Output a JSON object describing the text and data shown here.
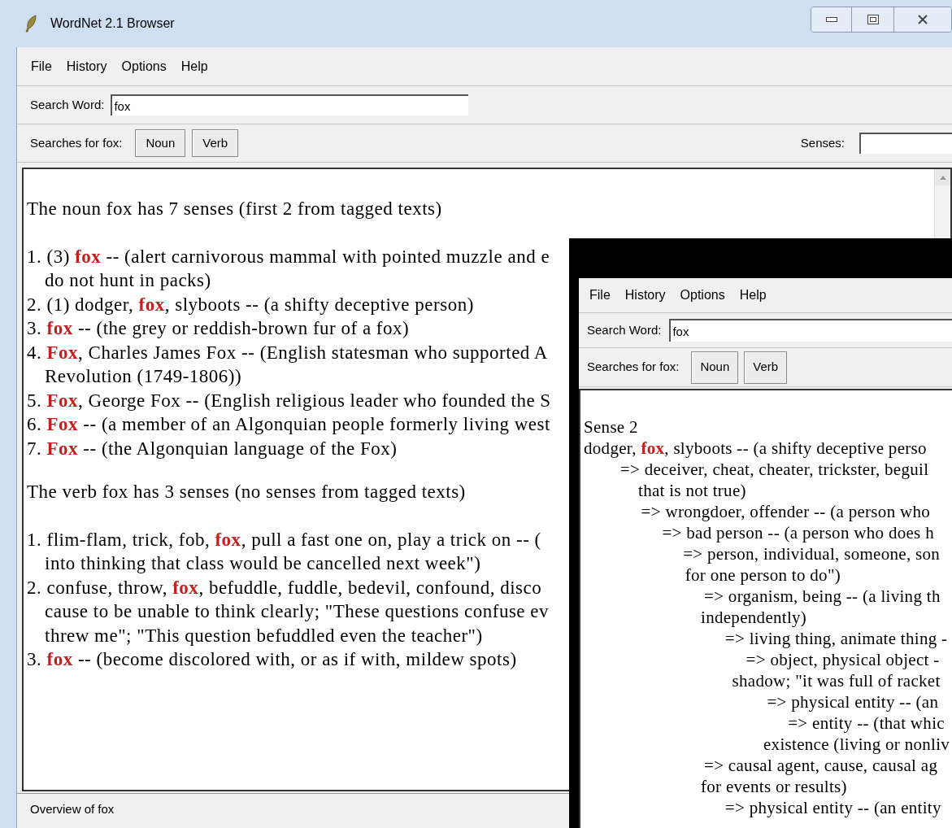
{
  "window": {
    "title": "WordNet 2.1 Browser"
  },
  "menu": [
    "File",
    "History",
    "Options",
    "Help"
  ],
  "search": {
    "label": "Search Word:",
    "value": "fox"
  },
  "searches": {
    "label": "Searches for fox:",
    "buttons": [
      "Noun",
      "Verb"
    ],
    "senses_label": "Senses:"
  },
  "results": [
    {
      "heading": "The noun fox has 7 senses (first 2 from tagged texts)",
      "senses": [
        {
          "lines": [
            "1. (3) **fox** -- (alert carnivorous mammal with pointed muzzle and e",
            "do not hunt in packs)"
          ]
        },
        {
          "lines": [
            "2. (1) dodger, **fox**, slyboots -- (a shifty deceptive person)"
          ]
        },
        {
          "lines": [
            "3. **fox** -- (the grey or reddish-brown fur of a fox)"
          ]
        },
        {
          "lines": [
            "4. **Fox**, Charles James Fox -- (English statesman who supported A",
            "Revolution (1749-1806))"
          ]
        },
        {
          "lines": [
            "5. **Fox**, George Fox -- (English religious leader who founded the S"
          ]
        },
        {
          "lines": [
            "6. **Fox** -- (a member of an Algonquian people formerly living west"
          ]
        },
        {
          "lines": [
            "7. **Fox** -- (the Algonquian language of the Fox)"
          ]
        }
      ]
    },
    {
      "heading": "The verb fox has 3 senses (no senses from tagged texts)",
      "senses": [
        {
          "lines": [
            "1. flim-flam, trick, fob, **fox**, pull a fast one on, play a trick on -- (",
            "into thinking that class would be cancelled next week\")"
          ]
        },
        {
          "lines": [
            "2. confuse, throw, **fox**, befuddle, fuddle, bedevil, confound, disco",
            "cause to be unable to think clearly; \"These questions confuse ev",
            "threw me\"; \"This question befuddled even the teacher\")"
          ]
        },
        {
          "lines": [
            "3. **fox** -- (become discolored with, or as if with, mildew spots)"
          ]
        }
      ]
    }
  ],
  "status_bar": "Overview of fox",
  "second_window": {
    "menu": [
      "File",
      "History",
      "Options",
      "Help"
    ],
    "search": {
      "label": "Search Word:",
      "value": "fox"
    },
    "searches": {
      "label": "Searches for fox:",
      "buttons": [
        "Noun",
        "Verb"
      ]
    },
    "heading": "Sense 2",
    "tree": {
      "lines": [
        "dodger, **fox**, slyboots -- (a shifty deceptive perso"
      ],
      "children": [
        {
          "lines": [
            "=> deceiver, cheat, cheater, trickster, beguil",
            "that is not true)"
          ],
          "children": [
            {
              "lines": [
                "=> wrongdoer, offender -- (a person who"
              ],
              "children": [
                {
                  "lines": [
                    "=> bad person -- (a person who does h"
                  ],
                  "children": [
                    {
                      "lines": [
                        "=> person, individual, someone, son",
                        "for one person to do\")"
                      ],
                      "children": [
                        {
                          "lines": [
                            "=> organism, being -- (a living th",
                            "independently)"
                          ],
                          "children": [
                            {
                              "lines": [
                                "=> living thing, animate thing -"
                              ],
                              "children": [
                                {
                                  "lines": [
                                    "=> object, physical object -",
                                    "shadow; \"it was full of racket"
                                  ],
                                  "children": [
                                    {
                                      "lines": [
                                        "=> physical entity -- (an"
                                      ],
                                      "children": [
                                        {
                                          "lines": [
                                            "=> entity -- (that whic",
                                            "existence (living or nonliv"
                                          ]
                                        }
                                      ]
                                    }
                                  ]
                                }
                              ]
                            }
                          ]
                        },
                        {
                          "lines": [
                            "=> causal agent, cause, causal ag",
                            "for events or results)"
                          ],
                          "children": [
                            {
                              "lines": [
                                "=> physical entity -- (an entity"
                              ]
                            }
                          ]
                        }
                      ]
                    }
                  ]
                }
              ]
            }
          ]
        }
      ]
    }
  }
}
